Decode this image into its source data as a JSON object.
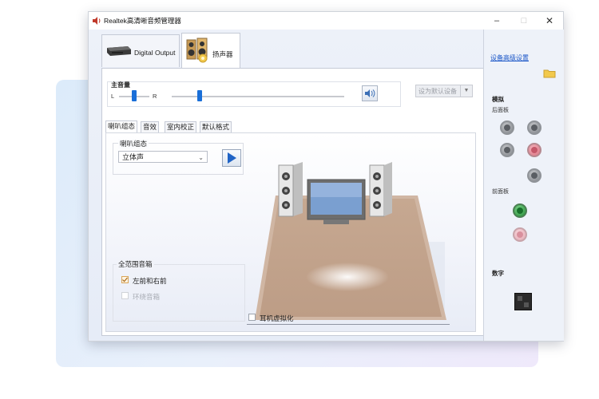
{
  "window": {
    "title": "Realtek高清晰音频管理器",
    "minimize_symbol": "–",
    "maximize_symbol": "□",
    "close_symbol": "✕"
  },
  "device_tabs": [
    {
      "label": "Digital Output",
      "icon": "digital-output-device-icon"
    },
    {
      "label": "扬声器",
      "icon": "speakers-icon",
      "active": true
    }
  ],
  "volume": {
    "label": "主音量",
    "left": "L",
    "right": "R",
    "balance": 0.5,
    "level": 0.15
  },
  "default_device_button": {
    "label": "设为默认设备",
    "enabled": false
  },
  "sub_tabs": [
    {
      "label": "喇叭组态",
      "active": true
    },
    {
      "label": "音效"
    },
    {
      "label": "室内校正"
    },
    {
      "label": "默认格式"
    }
  ],
  "speaker_config": {
    "label": "喇叭组态",
    "selected": "立体声"
  },
  "full_range": {
    "label": "全范围音箱",
    "front": {
      "label": "左前和右前",
      "checked": true,
      "enabled": true
    },
    "surround": {
      "label": "环绕音箱",
      "checked": false,
      "enabled": false
    }
  },
  "headphone_virtualization": {
    "label": "耳机虚拟化",
    "checked": false
  },
  "right_panel": {
    "advanced_link": "设备高级设置",
    "analog_label": "模拟",
    "back_panel_label": "后面板",
    "front_panel_label": "前面板",
    "digital_label": "数字",
    "back_jacks": [
      "gray",
      "gray",
      "gray",
      "pink",
      "gray"
    ],
    "front_jacks": [
      "green",
      "pink"
    ]
  },
  "colors": {
    "accent": "#1a6fd8",
    "floor": "#c4a58e",
    "link": "#1a56c8"
  }
}
